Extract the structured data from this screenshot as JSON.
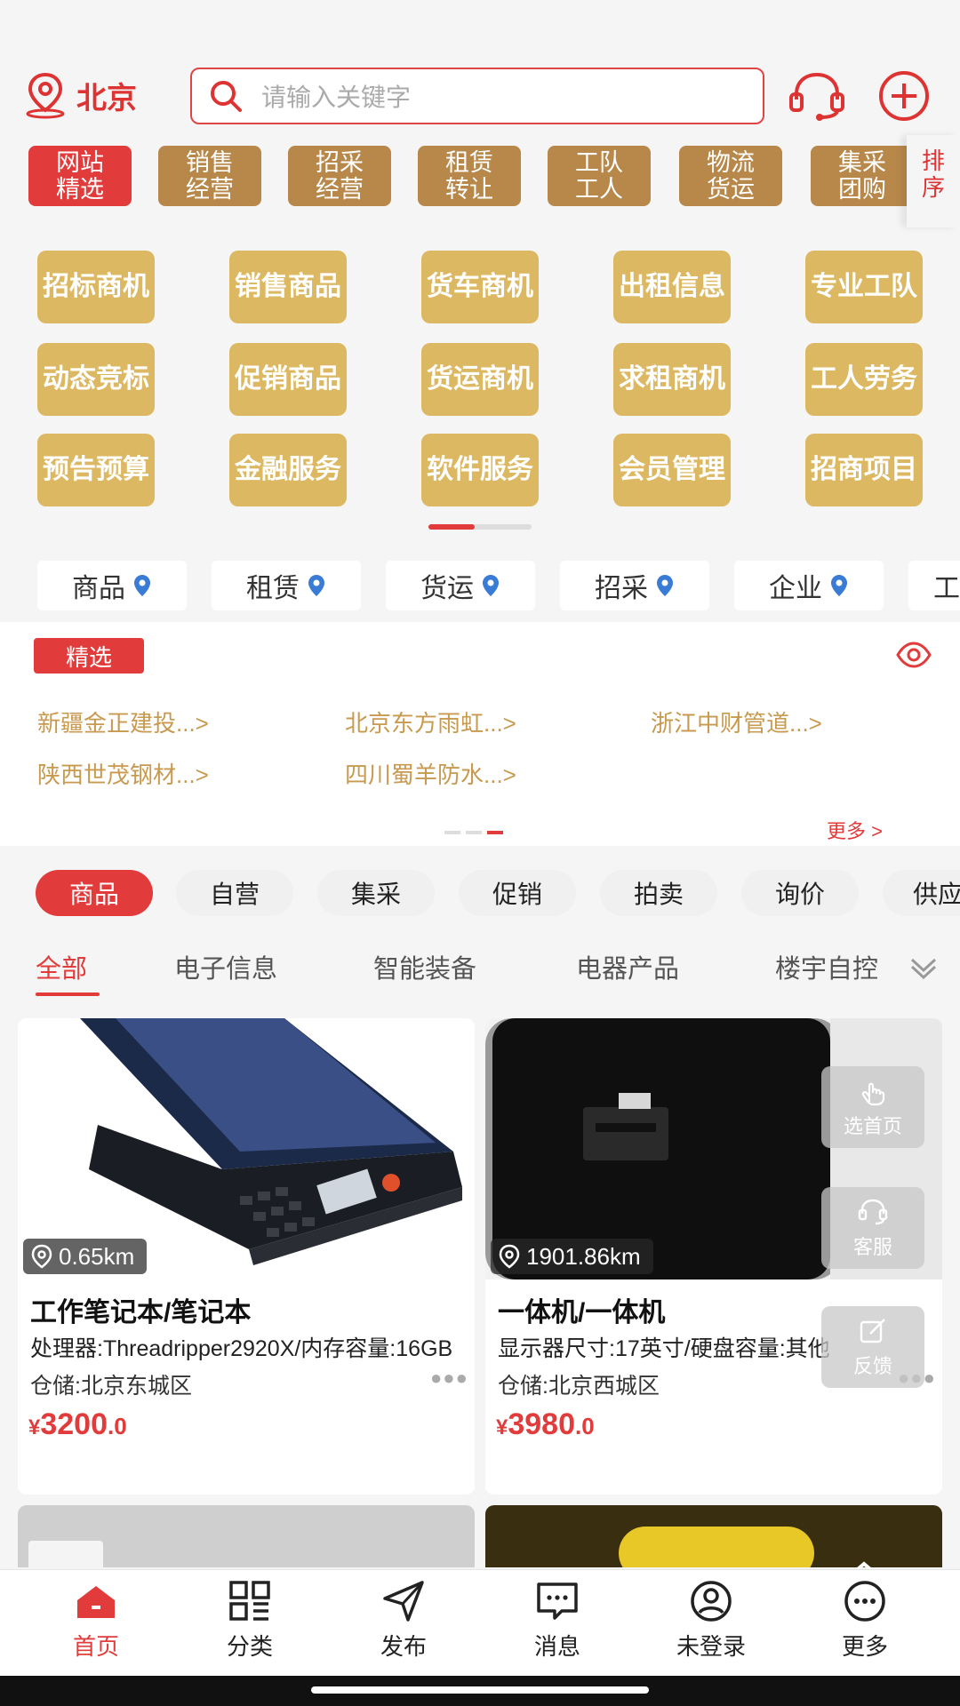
{
  "header": {
    "city": "北京",
    "search_placeholder": "请输入关键字"
  },
  "categories": [
    "网站\n精选",
    "销售\n经营",
    "招采\n经营",
    "租赁\n转让",
    "工队\n工人",
    "物流\n货运",
    "集采\n团购"
  ],
  "sort_label": "排序",
  "grid_tiles": [
    "招标商机",
    "销售商品",
    "货车商机",
    "出租信息",
    "专业工队",
    "动态竞标",
    "促销商品",
    "货运商机",
    "求租商机",
    "工人劳务",
    "预告预算",
    "金融服务",
    "软件服务",
    "会员管理",
    "招商项目"
  ],
  "nearby": [
    "商品",
    "租赁",
    "货运",
    "招采",
    "企业",
    "工"
  ],
  "featured": {
    "badge": "精选",
    "links": [
      "新疆金正建投...>",
      "北京东方雨虹...>",
      "浙江中财管道...>",
      "陕西世茂钢材...>",
      "四川蜀羊防水...>"
    ],
    "more": "更多 >"
  },
  "pills": [
    "商品",
    "自营",
    "集采",
    "促销",
    "拍卖",
    "询价",
    "供应"
  ],
  "subtabs": [
    "全部",
    "电子信息",
    "智能装备",
    "电器产品",
    "楼宇自控"
  ],
  "products": [
    {
      "distance": "0.65km",
      "title": "工作笔记本/笔记本",
      "spec": "处理器:Threadripper2920X/内存容量:16GB",
      "stock": "仓储:北京东城区",
      "price_cur": "¥",
      "price_int": "3200",
      "price_dec": ".0"
    },
    {
      "distance": "1901.86km",
      "title": "一体机/一体机",
      "spec": "显示器尺寸:17英寸/硬盘容量:其他",
      "stock": "仓储:北京西城区",
      "price_cur": "¥",
      "price_int": "3980",
      "price_dec": ".0"
    }
  ],
  "float_buttons": [
    "选首页",
    "客服",
    "反馈"
  ],
  "bottom_nav": [
    "首页",
    "分类",
    "发布",
    "消息",
    "未登录",
    "更多"
  ],
  "colors": {
    "accent": "#e23b3b",
    "gold": "#dcb862",
    "brown": "#b8884a"
  }
}
